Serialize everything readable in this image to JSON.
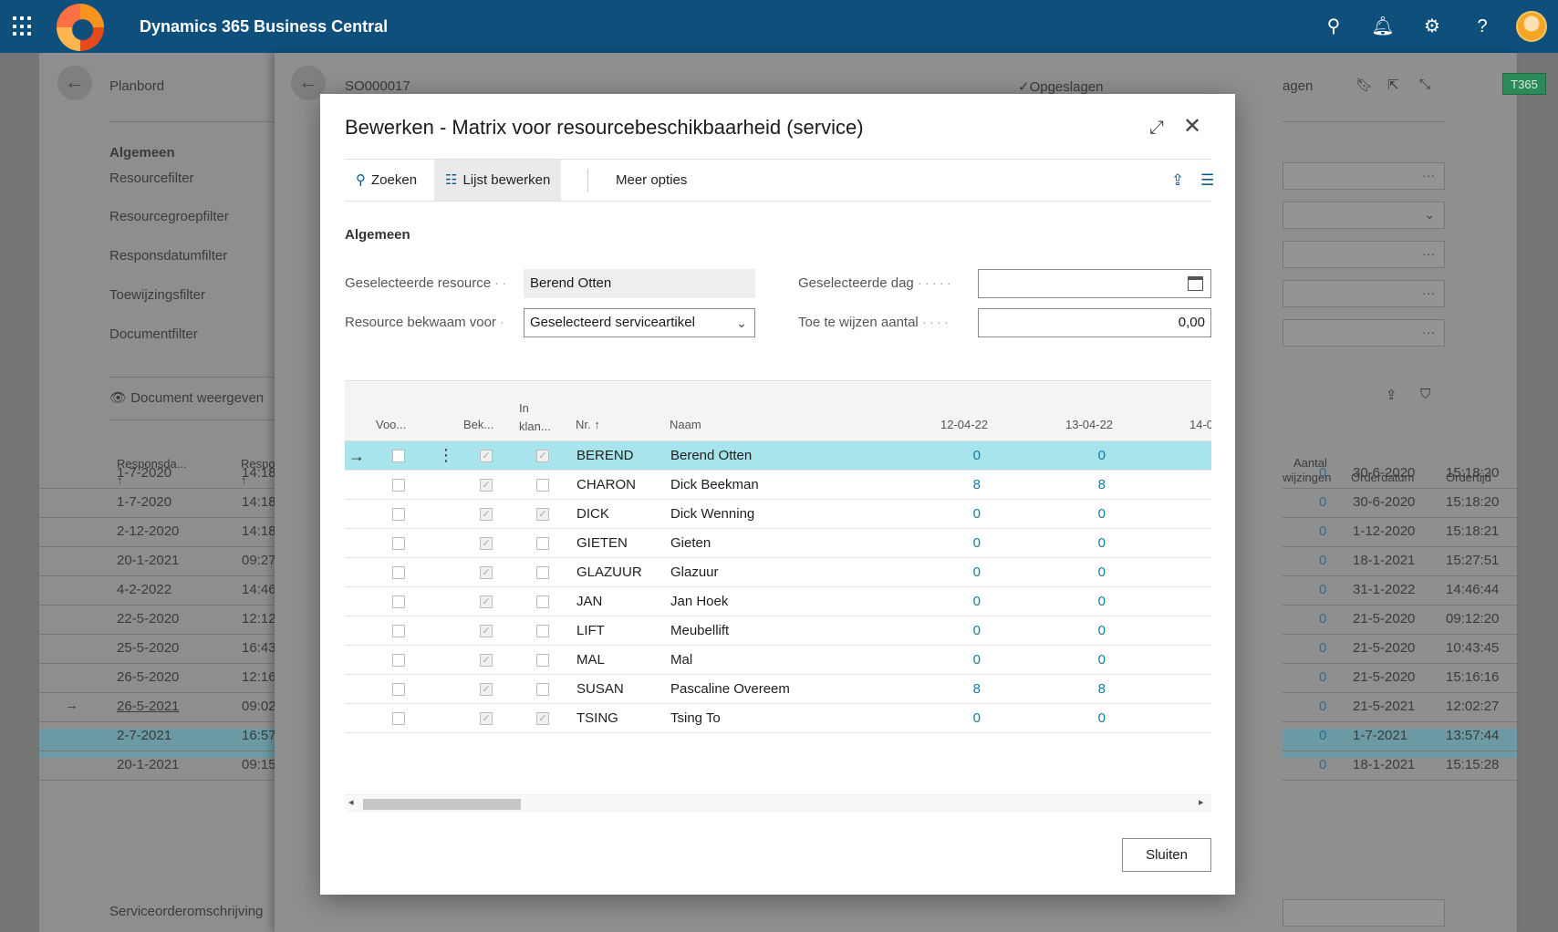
{
  "app": {
    "title": "Dynamics 365 Business Central"
  },
  "topbar_icons": [
    "search-icon",
    "bell-icon",
    "gear-icon",
    "help-icon"
  ],
  "bg_left": {
    "back_title": "Planbord",
    "section": "Algemeen",
    "fields": [
      "Resourcefilter",
      "Resourcegroepfilter",
      "Responsdatumfilter",
      "Toewijzingsfilter",
      "Documentfilter"
    ],
    "show_document": "Document weergeven",
    "col_headers": [
      "Responsda...",
      "Respo"
    ],
    "rows": [
      [
        "1-7-2020",
        "14:18"
      ],
      [
        "1-7-2020",
        "14:18"
      ],
      [
        "2-12-2020",
        "14:18"
      ],
      [
        "20-1-2021",
        "09:27"
      ],
      [
        "4-2-2022",
        "14:46"
      ],
      [
        "22-5-2020",
        "12:12"
      ],
      [
        "25-5-2020",
        "16:43"
      ],
      [
        "26-5-2020",
        "12:16"
      ],
      [
        "26-5-2021",
        "09:02"
      ],
      [
        "2-7-2021",
        "16:57"
      ],
      [
        "20-1-2021",
        "09:15"
      ]
    ],
    "footer": "Serviceorderomschrijving"
  },
  "bg_right": {
    "doc_no": "SO000017",
    "saved": "Opgeslagen",
    "partial_label": "agen",
    "tag": "T365",
    "col_headers": [
      "Aantal",
      "wijzingen",
      "Orderdatum",
      "Ordertijd"
    ],
    "rows": [
      [
        "0",
        "30-6-2020",
        "15:18:20"
      ],
      [
        "0",
        "30-6-2020",
        "15:18:20"
      ],
      [
        "0",
        "1-12-2020",
        "15:18:21"
      ],
      [
        "0",
        "18-1-2021",
        "15:27:51"
      ],
      [
        "0",
        "31-1-2022",
        "14:46:44"
      ],
      [
        "0",
        "21-5-2020",
        "09:12:20"
      ],
      [
        "0",
        "21-5-2020",
        "10:43:45"
      ],
      [
        "0",
        "21-5-2020",
        "15:16:16"
      ],
      [
        "0",
        "21-5-2021",
        "12:02:27"
      ],
      [
        "0",
        "1-7-2021",
        "13:57:44"
      ],
      [
        "0",
        "18-1-2021",
        "15:15:28"
      ]
    ]
  },
  "dialog": {
    "title": "Bewerken - Matrix voor resourcebeschikbaarheid (service)",
    "actions": {
      "search": "Zoeken",
      "edit_list": "Lijst bewerken",
      "more": "Meer opties"
    },
    "section": "Algemeen",
    "fields": {
      "selected_resource_label": "Geselecteerde resource",
      "selected_resource_value": "Berend Otten",
      "qualified_label": "Resource bekwaam voor",
      "qualified_value": "Geselecteerd serviceartikel",
      "selected_day_label": "Geselecteerde dag",
      "selected_day_value": "",
      "qty_label": "Toe te wijzen aantal",
      "qty_value": "0,00"
    },
    "grid": {
      "headers": {
        "voo": "Voo...",
        "bek": "Bek...",
        "in1": "In",
        "in2": "klan...",
        "nr": "Nr. ↑",
        "naam": "Naam",
        "d1": "12-04-22",
        "d2": "13-04-22",
        "d3": "14-0"
      },
      "rows": [
        {
          "nr": "BEREND",
          "naam": "Berend Otten",
          "v1": "0",
          "v2": "0",
          "inklant": true
        },
        {
          "nr": "CHARON",
          "naam": "Dick Beekman",
          "v1": "8",
          "v2": "8",
          "inklant": false
        },
        {
          "nr": "DICK",
          "naam": "Dick Wenning",
          "v1": "0",
          "v2": "0",
          "inklant": true
        },
        {
          "nr": "GIETEN",
          "naam": "Gieten",
          "v1": "0",
          "v2": "0",
          "inklant": false
        },
        {
          "nr": "GLAZUUR",
          "naam": "Glazuur",
          "v1": "0",
          "v2": "0",
          "inklant": false
        },
        {
          "nr": "JAN",
          "naam": "Jan Hoek",
          "v1": "0",
          "v2": "0",
          "inklant": false
        },
        {
          "nr": "LIFT",
          "naam": "Meubellift",
          "v1": "0",
          "v2": "0",
          "inklant": false
        },
        {
          "nr": "MAL",
          "naam": "Mal",
          "v1": "0",
          "v2": "0",
          "inklant": false
        },
        {
          "nr": "SUSAN",
          "naam": "Pascaline Overeem",
          "v1": "8",
          "v2": "8",
          "inklant": false
        },
        {
          "nr": "TSING",
          "naam": "Tsing To",
          "v1": "0",
          "v2": "0",
          "inklant": true
        }
      ]
    },
    "close_label": "Sluiten"
  }
}
